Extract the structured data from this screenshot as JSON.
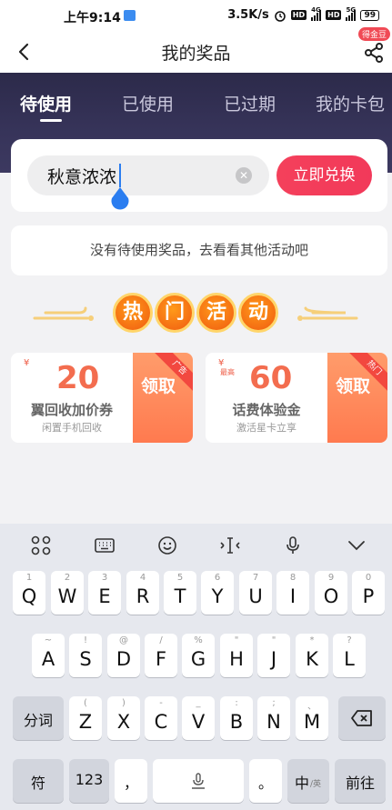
{
  "status_bar": {
    "time": "上午9:14",
    "net_speed": "3.5K/s",
    "hd1": "HD",
    "net1": "4G",
    "hd2": "HD",
    "net2": "5G",
    "battery": "99"
  },
  "header": {
    "title": "我的奖品",
    "coin_badge": "得金豆"
  },
  "tabs": [
    "待使用",
    "已使用",
    "已过期",
    "我的卡包"
  ],
  "redeem": {
    "input_value": "秋意浓浓",
    "button_label": "立即兑换"
  },
  "empty_notice": "没有待使用奖品，去看看其他活动吧",
  "hot_activities": {
    "chars": [
      "热",
      "门",
      "活",
      "动"
    ]
  },
  "promos": [
    {
      "currency": "¥",
      "max_label": "",
      "amount": "20",
      "title": "翼回收加价券",
      "subtitle": "闲置手机回收",
      "claim": "领取",
      "ribbon": "广告"
    },
    {
      "currency": "¥",
      "max_label": "最高",
      "amount": "60",
      "title": "话费体验金",
      "subtitle": "激活星卡立享",
      "claim": "领取",
      "ribbon": "热门"
    }
  ],
  "keyboard": {
    "row1": [
      {
        "main": "Q",
        "hint": "1"
      },
      {
        "main": "W",
        "hint": "2"
      },
      {
        "main": "E",
        "hint": "3"
      },
      {
        "main": "R",
        "hint": "4"
      },
      {
        "main": "T",
        "hint": "5"
      },
      {
        "main": "Y",
        "hint": "6"
      },
      {
        "main": "U",
        "hint": "7"
      },
      {
        "main": "I",
        "hint": "8"
      },
      {
        "main": "O",
        "hint": "9"
      },
      {
        "main": "P",
        "hint": "0"
      }
    ],
    "row2": [
      {
        "main": "A",
        "hint": "~"
      },
      {
        "main": "S",
        "hint": "!"
      },
      {
        "main": "D",
        "hint": "@"
      },
      {
        "main": "F",
        "hint": "/"
      },
      {
        "main": "G",
        "hint": "%"
      },
      {
        "main": "H",
        "hint": "\""
      },
      {
        "main": "J",
        "hint": "\""
      },
      {
        "main": "K",
        "hint": "*"
      },
      {
        "main": "L",
        "hint": "?"
      }
    ],
    "row3": [
      {
        "main": "Z",
        "hint": "("
      },
      {
        "main": "X",
        "hint": ")"
      },
      {
        "main": "C",
        "hint": "-"
      },
      {
        "main": "V",
        "hint": "_"
      },
      {
        "main": "B",
        "hint": ":"
      },
      {
        "main": "N",
        "hint": ";"
      },
      {
        "main": "M",
        "hint": "、"
      }
    ],
    "segment_label": "分词",
    "symbol_label": "符",
    "num_label": "123",
    "comma": "，",
    "period": "。",
    "lang_label": "中",
    "lang_sub": "/英",
    "go_label": "前往"
  }
}
